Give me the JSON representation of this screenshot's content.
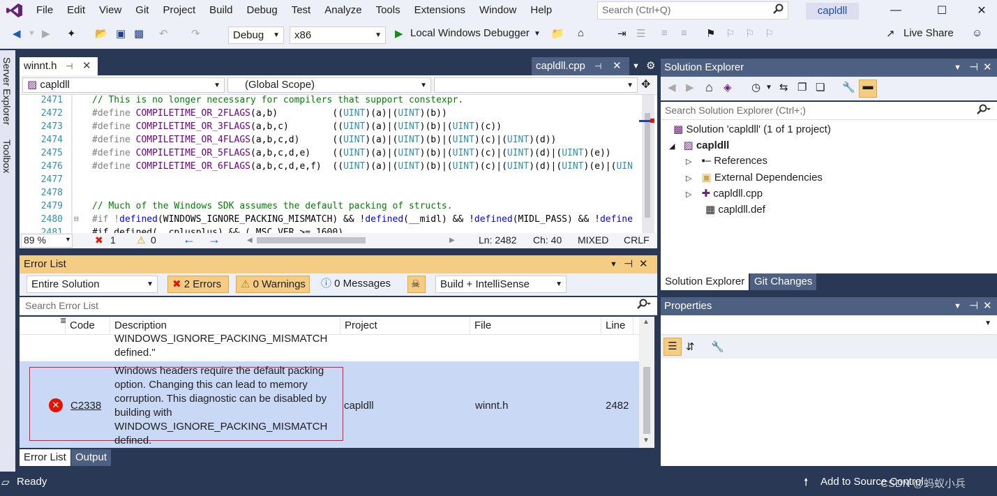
{
  "menu": {
    "items": [
      "File",
      "Edit",
      "View",
      "Git",
      "Project",
      "Build",
      "Debug",
      "Test",
      "Analyze",
      "Tools",
      "Extensions",
      "Window",
      "Help"
    ],
    "search_placeholder": "Search (Ctrl+Q)",
    "solution_name": "capldll"
  },
  "toolbar": {
    "config": "Debug",
    "platform": "x86",
    "debugger": "Local Windows Debugger",
    "live_share": "Live Share"
  },
  "side_tabs": [
    "Server Explorer",
    "Toolbox"
  ],
  "editor": {
    "tabs": {
      "active": "winnt.h",
      "right": "capldll.cpp"
    },
    "project_combo": "capldll",
    "scope_combo": "(Global Scope)",
    "lines": [
      {
        "n": "2471",
        "text": "// This is no longer necessary for compilers that support constexpr."
      },
      {
        "n": "2472",
        "text": "#define COMPILETIME_OR_2FLAGS(a,b)          ((UINT)(a)|(UINT)(b))"
      },
      {
        "n": "2473",
        "text": "#define COMPILETIME_OR_3FLAGS(a,b,c)        ((UINT)(a)|(UINT)(b)|(UINT)(c))"
      },
      {
        "n": "2474",
        "text": "#define COMPILETIME_OR_4FLAGS(a,b,c,d)      ((UINT)(a)|(UINT)(b)|(UINT)(c)|(UINT)(d))"
      },
      {
        "n": "2475",
        "text": "#define COMPILETIME_OR_5FLAGS(a,b,c,d,e)    ((UINT)(a)|(UINT)(b)|(UINT)(c)|(UINT)(d)|(UINT)(e))"
      },
      {
        "n": "2476",
        "text": "#define COMPILETIME_OR_6FLAGS(a,b,c,d,e,f)  ((UINT)(a)|(UINT)(b)|(UINT)(c)|(UINT)(d)|(UINT)(e)|(UIN"
      },
      {
        "n": "2477",
        "text": ""
      },
      {
        "n": "2478",
        "text": ""
      },
      {
        "n": "2479",
        "text": "// Much of the Windows SDK assumes the default packing of structs."
      },
      {
        "n": "2480",
        "text": "#if !defined(WINDOWS_IGNORE_PACKING_MISMATCH) && !defined(__midl) && !defined(MIDL_PASS) && !define"
      },
      {
        "n": "2481",
        "text": "#if defined(__cplusplus) && (_MSC_VER >= 1600)"
      }
    ],
    "status": {
      "zoom": "89 %",
      "errors": "1",
      "warnings": "0",
      "ln": "Ln: 2482",
      "ch": "Ch: 40",
      "eol_mode": "MIXED",
      "eol": "CRLF"
    }
  },
  "error_list": {
    "title": "Error List",
    "scope": "Entire Solution",
    "errors_btn": "2 Errors",
    "warnings_btn": "0 Warnings",
    "messages_btn": "0 Messages",
    "source": "Build + IntelliSense",
    "search_placeholder": "Search Error List",
    "columns": {
      "code": "Code",
      "description": "Description",
      "project": "Project",
      "file": "File",
      "line": "Line"
    },
    "prev_row_tail": [
      "WINDOWS_IGNORE_PACKING_MISMATCH",
      "defined.\""
    ],
    "row": {
      "code": "C2338",
      "description": [
        "Windows headers require the default packing",
        "option. Changing this can lead to memory",
        "corruption. This diagnostic can be disabled by",
        "building with",
        "WINDOWS_IGNORE_PACKING_MISMATCH",
        "defined."
      ],
      "project": "capldll",
      "file": "winnt.h",
      "line": "2482"
    },
    "tabs": [
      "Error List",
      "Output"
    ]
  },
  "solution_explorer": {
    "title": "Solution Explorer",
    "search_placeholder": "Search Solution Explorer (Ctrl+;)",
    "solution": "Solution 'capldll' (1 of 1 project)",
    "project": "capldll",
    "items": [
      "References",
      "External Dependencies",
      "capldll.cpp",
      "capldll.def"
    ],
    "tabs": [
      "Solution Explorer",
      "Git Changes"
    ]
  },
  "properties": {
    "title": "Properties"
  },
  "statusbar": {
    "ready": "Ready",
    "source_control": "Add to Source Control",
    "watermark": "CSDN @蚂蚁小兵"
  },
  "colors": {
    "accent": "#68217a",
    "header_blue": "#4d6082",
    "error_red": "#e51400",
    "tab_gold": "#f5cc84",
    "selection": "#c9d8f5"
  }
}
